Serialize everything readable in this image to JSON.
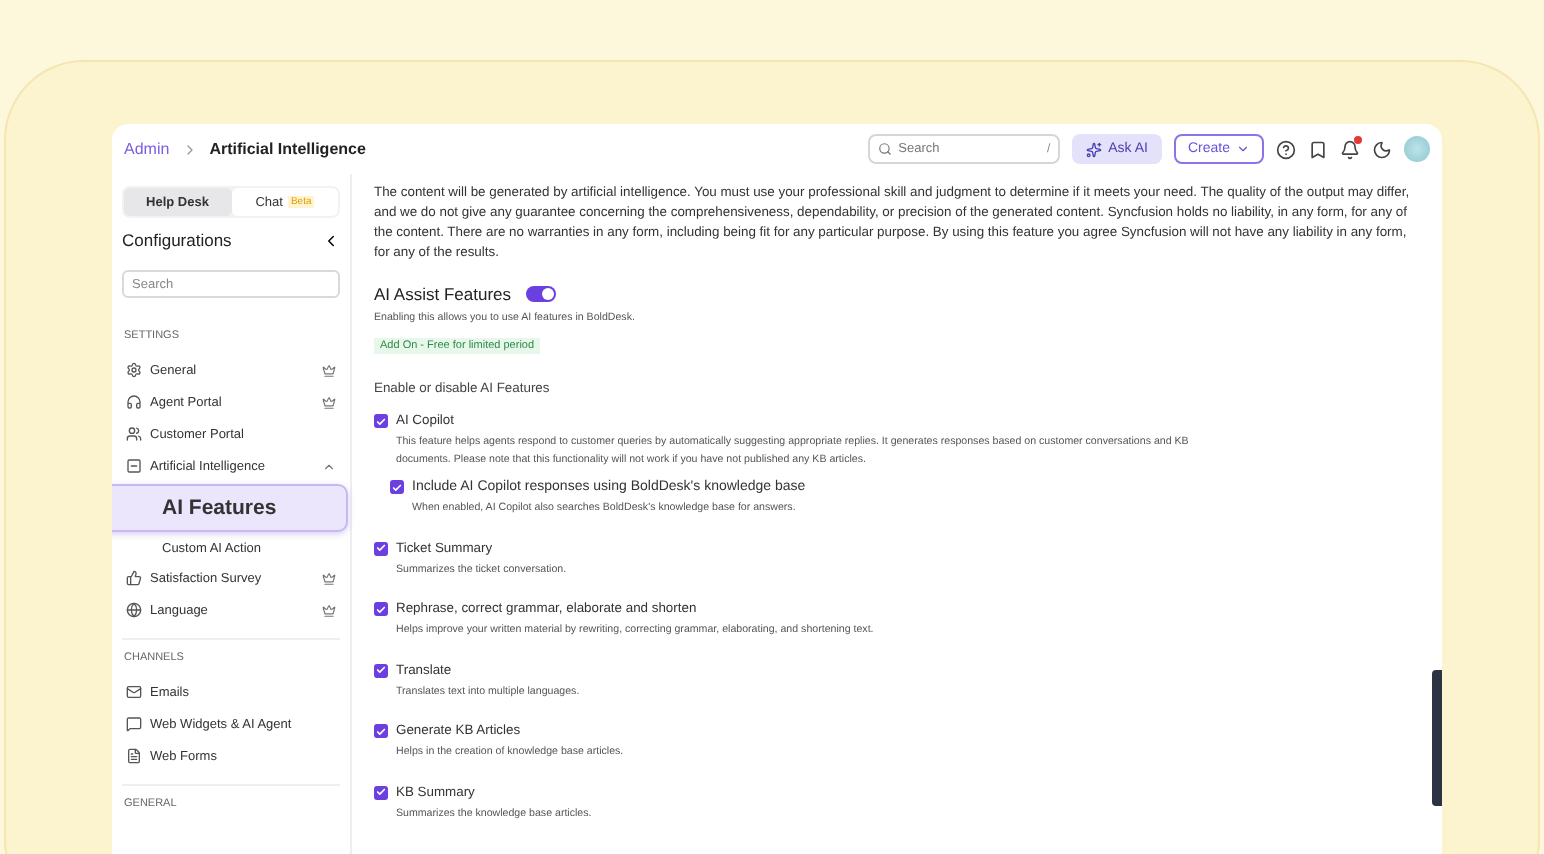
{
  "breadcrumb": [
    {
      "label": "Admin"
    },
    {
      "label": "Artificial Intelligence"
    }
  ],
  "topbar": {
    "search_placeholder": "Search",
    "search_shortcut": "/",
    "ask_ai": "Ask AI",
    "create": "Create"
  },
  "sidebar": {
    "tabs": [
      {
        "label": "Help Desk",
        "selected": true
      },
      {
        "label": "Chat",
        "badge": "Beta",
        "selected": false
      }
    ],
    "title": "Configurations",
    "search_placeholder": "Search",
    "sections": [
      {
        "heading": "SETTINGS",
        "items": [
          {
            "label": "General",
            "premium": true
          },
          {
            "label": "Agent Portal",
            "premium": true
          },
          {
            "label": "Customer Portal",
            "premium": false
          },
          {
            "label": "Artificial Intelligence",
            "premium": false,
            "expanded": true,
            "children": [
              {
                "label": "AI Features",
                "selected": true
              },
              {
                "label": "Custom AI Action",
                "selected": false
              }
            ]
          },
          {
            "label": "Satisfaction Survey",
            "premium": true
          },
          {
            "label": "Language",
            "premium": true
          }
        ]
      },
      {
        "heading": "CHANNELS",
        "items": [
          {
            "label": "Emails",
            "premium": false
          },
          {
            "label": "Web Widgets & AI Agent",
            "premium": false
          },
          {
            "label": "Web Forms",
            "premium": false
          }
        ]
      },
      {
        "heading": "GENERAL"
      }
    ]
  },
  "disclaimer": "The content will be generated by artificial intelligence. You must use your professional skill and judgment to determine if it meets your need. The quality of the output may differ, and we do not give any guarantee concerning the comprehensiveness, dependability, or precision of the generated content. Syncfusion holds no liability, in any form, for any of the content. There are no warranties in any form, including being fit for any particular purpose. By using this feature you agree Syncfusion will not have any liability in any form, for any of the results.",
  "assist": {
    "title": "AI Assist Features",
    "on": true,
    "description": "Enabling this allows you to use AI features in BoldDesk.",
    "addon": "Add On - Free for limited period"
  },
  "features_heading": "Enable or disable AI Features",
  "features": [
    {
      "title": "AI Copilot",
      "checked": true,
      "description": "This feature helps agents respond to customer queries by automatically suggesting appropriate replies. It generates responses based on customer conversations and KB documents. Please note that this functionality will not work if you have not published any KB articles.",
      "children": [
        {
          "title": "Include AI Copilot responses using BoldDesk's knowledge base",
          "checked": true,
          "description": "When enabled, AI Copilot also searches BoldDesk's knowledge base for answers."
        }
      ]
    },
    {
      "title": "Ticket Summary",
      "checked": true,
      "description": "Summarizes the ticket conversation."
    },
    {
      "title": "Rephrase, correct grammar, elaborate and shorten",
      "checked": true,
      "description": "Helps improve your written material by rewriting, correcting grammar, elaborating, and shortening text."
    },
    {
      "title": "Translate",
      "checked": true,
      "description": "Translates text into multiple languages."
    },
    {
      "title": "Generate KB Articles",
      "checked": true,
      "description": "Helps in the creation of knowledge base articles."
    },
    {
      "title": "KB Summary",
      "checked": true,
      "description": "Summarizes the knowledge base articles."
    }
  ]
}
